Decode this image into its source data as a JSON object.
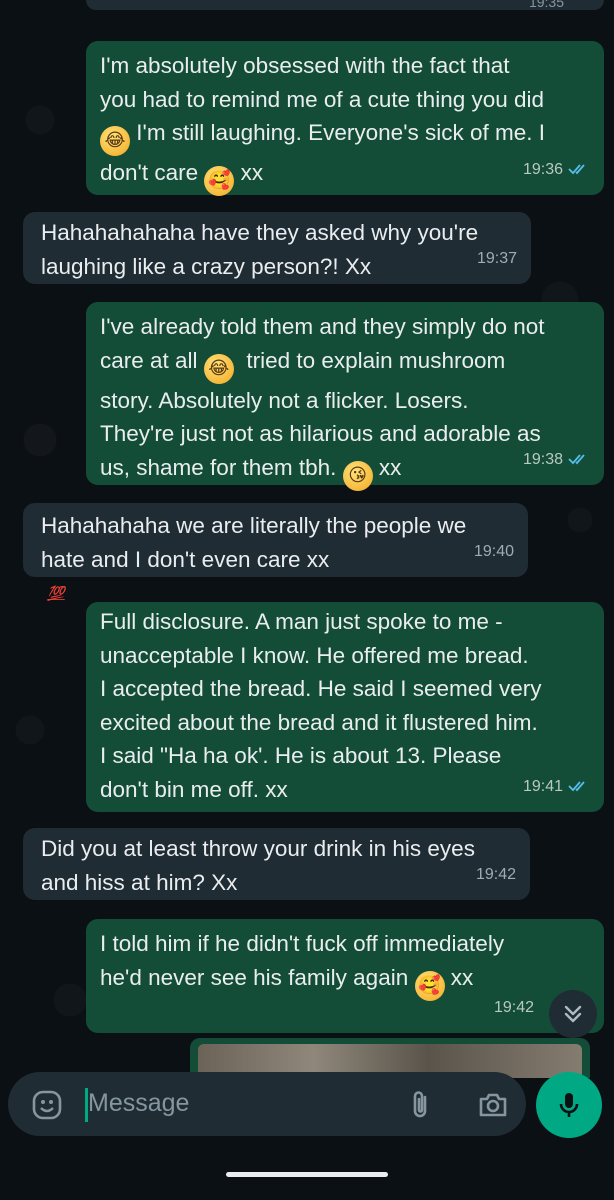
{
  "top_partial_time": "19:35",
  "messages": [
    {
      "id": "m1",
      "dir": "out",
      "lines": [
        "I'm absolutely obsessed with the fact that",
        "you had to remind me of a cute thing you did",
        "[rofl] I'm still laughing. Everyone's sick of me. I",
        "don't care [smiling-hearts] xx"
      ],
      "time": "19:36",
      "status": "read"
    },
    {
      "id": "m2",
      "dir": "in",
      "lines": [
        "Hahahahahaha have they asked why you're",
        "laughing like a crazy person?! Xx"
      ],
      "time": "19:37"
    },
    {
      "id": "m3",
      "dir": "out",
      "lines": [
        "I've already told them and they simply do not",
        "care at all [rofl]  tried to explain mushroom",
        "story. Absolutely not a flicker. Losers.",
        "They're just not as hilarious and adorable as",
        "us, shame for them tbh. [kiss] xx"
      ],
      "time": "19:38",
      "status": "read"
    },
    {
      "id": "m4",
      "dir": "in",
      "lines": [
        "Hahahahaha we are literally the people we",
        "hate and I don't even care xx"
      ],
      "time": "19:40",
      "reaction": "💯"
    },
    {
      "id": "m5",
      "dir": "out",
      "lines": [
        "Full disclosure. A man just spoke to me -",
        "unacceptable I know. He offered me bread.",
        "I accepted the bread. He said I seemed very",
        "excited about the bread and it flustered him.",
        "I said \"Ha ha ok'. He is about 13. Please",
        "don't bin me off. xx"
      ],
      "time": "19:41",
      "status": "read"
    },
    {
      "id": "m6",
      "dir": "in",
      "lines": [
        "Did you at least throw your drink in his eyes",
        "and hiss at him? Xx"
      ],
      "time": "19:42"
    },
    {
      "id": "m7",
      "dir": "out",
      "lines": [
        "I told him if he didn't fuck off immediately",
        "he'd never see his family again [smiling-hearts] xx"
      ],
      "time": "19:42"
    }
  ],
  "input": {
    "placeholder": "Message"
  },
  "icons": {
    "emoji": "emoji-icon",
    "attach": "paperclip-icon",
    "camera": "camera-icon",
    "mic": "mic-icon",
    "scroll": "double-chevron-down-icon"
  },
  "colors": {
    "outgoing": "#144d37",
    "incoming": "#202c33",
    "accent": "#00a884",
    "read_tick": "#53bdeb"
  }
}
